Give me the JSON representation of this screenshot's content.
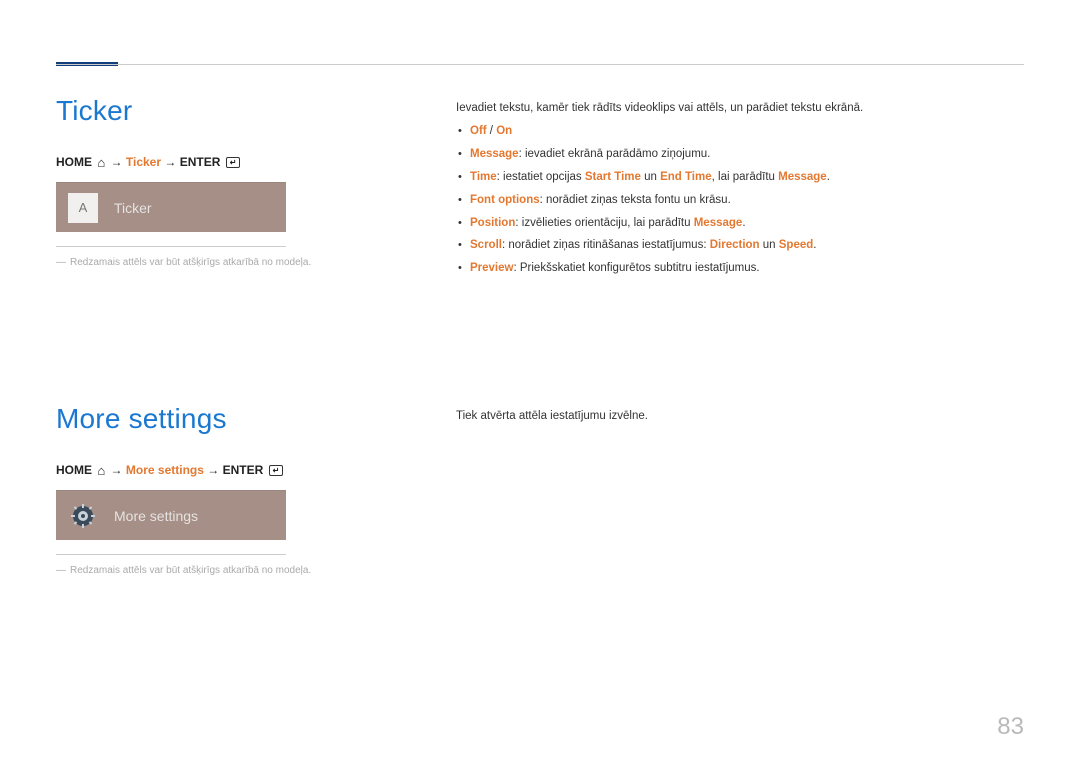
{
  "page_number": "83",
  "section1": {
    "heading": "Ticker",
    "breadcrumb": {
      "home": "HOME",
      "arrow": "→",
      "item": "Ticker",
      "enter": "ENTER"
    },
    "tile": {
      "icon_letter": "A",
      "label": "Ticker"
    },
    "footnote_dash": "―",
    "footnote": "Redzamais attēls var būt atšķirīgs atkarībā no modeļa.",
    "intro": "Ievadiet tekstu, kamēr tiek rādīts videoklips vai attēls, un parādiet tekstu ekrānā.",
    "bullets": {
      "b0_off": "Off",
      "b0_sep": " / ",
      "b0_on": "On",
      "b1_key": "Message",
      "b1_text": ": ievadiet ekrānā parādāmo ziņojumu.",
      "b2_key": "Time",
      "b2_t1": ": iestatiet opcijas ",
      "b2_start": "Start Time",
      "b2_t2": " un ",
      "b2_end": "End Time",
      "b2_t3": ", lai parādītu ",
      "b2_msg": "Message",
      "b2_dot": ".",
      "b3_key": "Font options",
      "b3_text": ": norādiet ziņas teksta fontu un krāsu.",
      "b4_key": "Position",
      "b4_t1": ": izvēlieties orientāciju, lai parādītu ",
      "b4_msg": "Message",
      "b4_dot": ".",
      "b5_key": "Scroll",
      "b5_t1": ": norādiet ziņas ritināšanas iestatījumus: ",
      "b5_dir": "Direction",
      "b5_t2": " un ",
      "b5_spd": "Speed",
      "b5_dot": ".",
      "b6_key": "Preview",
      "b6_text": ": Priekšskatiet konfigurētos subtitru iestatījumus."
    }
  },
  "section2": {
    "heading": "More settings",
    "breadcrumb": {
      "home": "HOME",
      "arrow": "→",
      "item": "More settings",
      "enter": "ENTER"
    },
    "tile": {
      "label": "More settings"
    },
    "footnote_dash": "―",
    "footnote": "Redzamais attēls var būt atšķirīgs atkarībā no modeļa.",
    "intro": "Tiek atvērta attēla iestatījumu izvēlne."
  }
}
